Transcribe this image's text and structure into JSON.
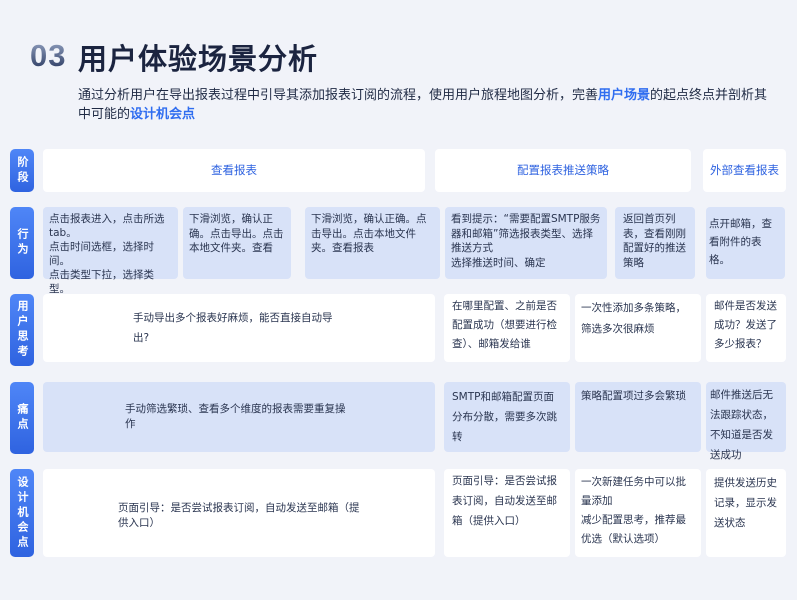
{
  "header": {
    "num": "03",
    "title": "用户体验场景分析",
    "intro_a": "通过分析用户在导出报表过程中引导其添加报表订阅的流程，使用用户旅程地图分析，完善",
    "intro_hl1": "用户场景",
    "intro_b": "的起点终点并剖析其中可能的",
    "intro_hl2": "设计机会点"
  },
  "rows": {
    "stage": "阶段",
    "action": "行为",
    "think": "用户思考",
    "pain": "痛点",
    "opp": "设计机会点"
  },
  "stages": [
    "查看报表",
    "配置报表推送策略",
    "外部查看报表"
  ],
  "actions": [
    "点击报表进入，点击所选tab。\n点击时间选框，选择时间。\n点击类型下拉，选择类型。",
    "下滑浏览，确认正确。点击导出。点击本地文件夹。查看",
    "下滑浏览，确认正确。点击导出。点击本地文件夹。查看报表",
    "看到提示：“需要配置SMTP服务器和邮箱”筛选报表类型、选择推送方式\n选择推送时间、确定",
    "返回首页列表，查看刚刚配置好的推送策略",
    "点开邮箱，查看附件的表格。"
  ],
  "thoughts": [
    "手动导出多个报表好麻烦，能否直接自动导出?",
    "在哪里配置、之前是否配置成功（想要进行检查）、邮箱发给谁",
    "一次性添加多条策略，筛选多次很麻烦",
    "邮件是否发送成功？发送了多少报表？"
  ],
  "pains": [
    "手动筛选繁琐、查看多个维度的报表需要重复操作",
    "SMTP和邮箱配置页面分布分散，需要多次跳转",
    "策略配置项过多会繁琐",
    "邮件推送后无法跟踪状态，不知道是否发送成功"
  ],
  "opps": [
    "页面引导：是否尝试报表订阅，自动发送至邮箱（提供入口）",
    "页面引导：是否尝试报表订阅，自动发送至邮箱（提供入口）",
    "一次新建任务中可以批量添加\n减少配置思考，推荐最优选（默认选项）",
    "提供发送历史记录，显示发送状态"
  ]
}
